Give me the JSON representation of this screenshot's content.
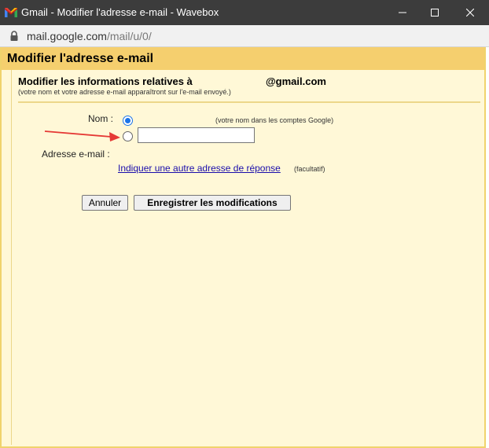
{
  "window": {
    "title": "Gmail - Modifier l'adresse e-mail - Wavebox",
    "controls": [
      "minimize-icon",
      "maximize-icon",
      "close-icon"
    ]
  },
  "address_bar": {
    "icon": "lock-icon",
    "url_host": "mail.google.com",
    "url_path": "/mail/u/0/"
  },
  "dialog": {
    "title": "Modifier l'adresse e-mail",
    "info_title": "Modifier les informations relatives à",
    "email_suffix": "@gmail.com",
    "info_note": "(votre nom et votre adresse e-mail apparaîtront sur l'e-mail envoyé.)",
    "name_label": "Nom :",
    "google_name_note": "(votre nom dans les comptes Google)",
    "custom_name_value": "",
    "email_label": "Adresse e-mail :",
    "reply_link": "Indiquer une autre adresse de réponse",
    "optional_note": "(facultatif)",
    "cancel_label": "Annuler",
    "save_label": "Enregistrer les modifications"
  },
  "colors": {
    "titlebar": "#3c3c3c",
    "dialog_header": "#f5cf6e",
    "dialog_background": "#fff8d7",
    "annotation_arrow": "#e53935",
    "link": "#1a0dab"
  }
}
